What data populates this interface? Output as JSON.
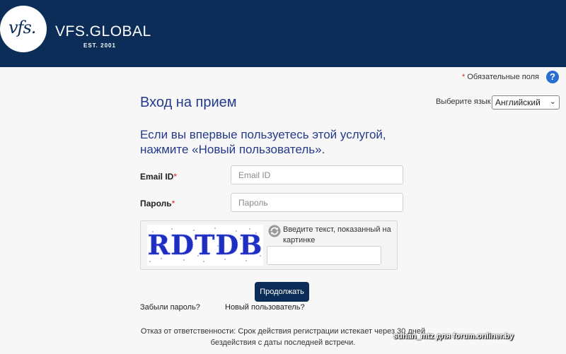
{
  "header": {
    "logo_mark": "vfs.",
    "brand": "VFS.GLOBAL",
    "brand_sub": "EST. 2001",
    "bg_color": "#0b2d57"
  },
  "required_note": "Обязательные поля",
  "required_star": "*",
  "help_icon": "?",
  "page_title": "Вход на прием",
  "language": {
    "label": "Выберите язык",
    "selected": "Английский"
  },
  "intro_text": "Если вы впервые пользуетесь этой услугой, нажмите «Новый пользователь».",
  "form": {
    "email_label": "Email ID",
    "email_placeholder": "Email ID",
    "password_label": "Пароль",
    "password_placeholder": "Пароль",
    "required_mark": "*"
  },
  "captcha": {
    "image_text": "RDTDB",
    "prompt": "Введите текст, показанный на картинке"
  },
  "continue_label": "Продолжать",
  "links": {
    "forgot_password": "Забыли пароль?",
    "new_user": "Новый пользователь?"
  },
  "disclaimer": "Отказ от ответственности: Срок действия регистрации истекает через 30 дней бездействия с даты последней встречи.",
  "watermark": "suhan_mtz для forum.onliner.by"
}
